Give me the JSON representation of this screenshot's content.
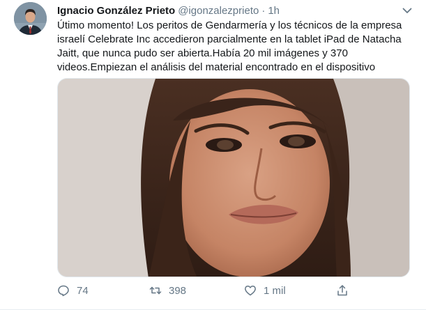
{
  "tweet": {
    "author": {
      "display_name": "Ignacio González Prieto",
      "handle": "@igonzalezprieto",
      "separator": "·",
      "time": "1h"
    },
    "text": "Útimo momento! Los peritos de Gendarmería y los técnicos de la empresa israelí Celebrate Inc accedieron parcialmente en la tablet iPad de Natacha Jaitt, que nunca pudo ser abierta.Había 20 mil imágenes y 370 videos.Empiezan el análisis del material encontrado en el dispositivo",
    "actions": {
      "replies": "74",
      "retweets": "398",
      "likes": "1 mil"
    }
  },
  "colors": {
    "text": "#14171a",
    "secondary": "#657786",
    "border": "#e1e8ed"
  },
  "icons": [
    "chevron-down-icon",
    "reply-icon",
    "retweet-icon",
    "like-icon",
    "share-icon"
  ]
}
